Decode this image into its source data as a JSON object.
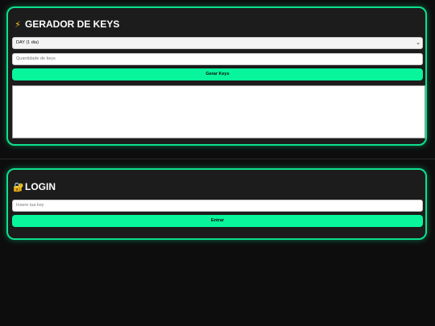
{
  "generator": {
    "title_icon": "lightning-bolt-icon",
    "title": "GERADOR DE KEYS",
    "plan_select": {
      "value": "DAY (1 dia)"
    },
    "quantity_input": {
      "placeholder": "Quantidade de keys",
      "value": ""
    },
    "generate_button": "Gerar Keys",
    "output": ""
  },
  "login": {
    "title_icon": "lock-with-key-icon",
    "title": "LOGIN",
    "key_input": {
      "placeholder": "Insere tua key",
      "value": ""
    },
    "enter_button": "Entrar"
  },
  "colors": {
    "accent": "#08f59c",
    "card_border": "#0ee08f",
    "card_background": "#1c1c1c",
    "page_background": "#0d0d0d"
  }
}
